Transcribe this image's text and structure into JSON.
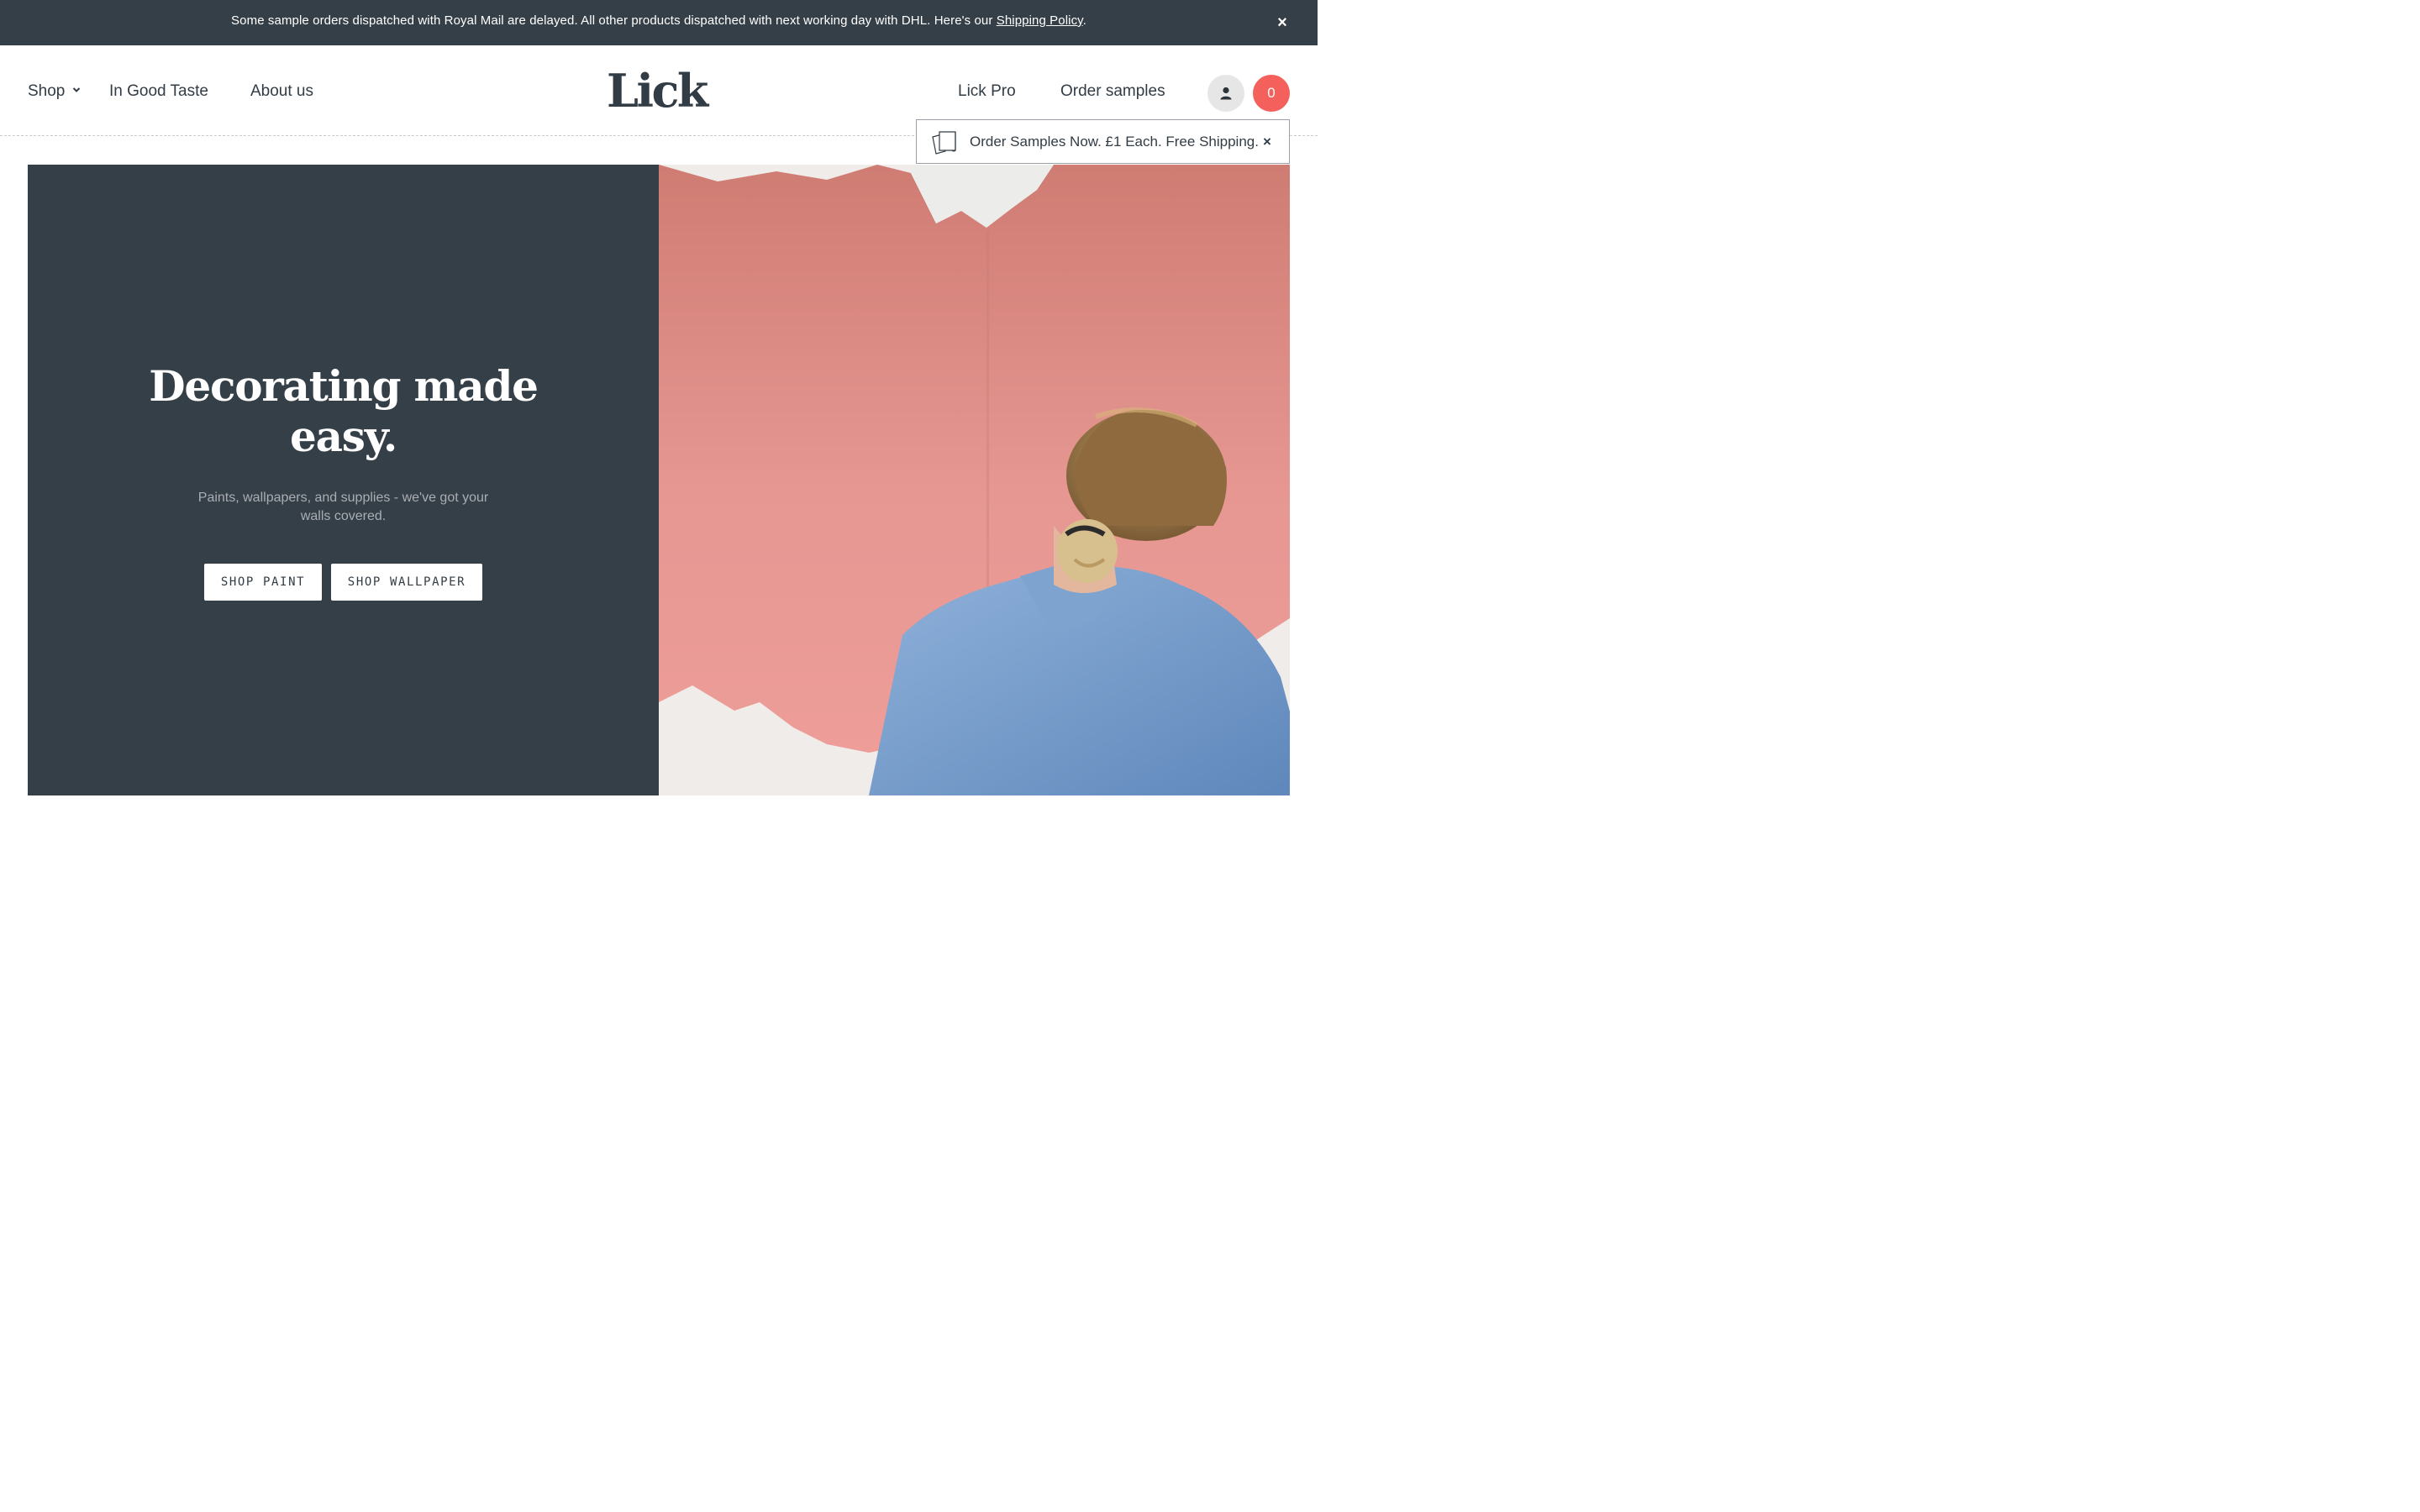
{
  "announcement": {
    "text": "Some sample orders dispatched with Royal Mail are delayed. All other products dispatched with next working day with DHL. Here's our ",
    "link_text": "Shipping Policy",
    "suffix": ".",
    "close_icon": "close-icon"
  },
  "header": {
    "nav_left": {
      "shop": "Shop",
      "in_good_taste": "In Good Taste",
      "about": "About us"
    },
    "logo": "Lick",
    "nav_right": {
      "pro": "Lick Pro",
      "samples": "Order samples"
    },
    "account_icon": "user-icon",
    "cart_count": "0"
  },
  "samples_popup": {
    "icon": "sample-cards-icon",
    "message": "Order Samples Now. £1 Each. Free Shipping.",
    "close_icon": "close-icon"
  },
  "hero": {
    "title": "Decorating made easy.",
    "subtitle": "Paints, wallpapers, and supplies - we've got your walls covered.",
    "buttons": {
      "paint": "SHOP PAINT",
      "wallpaper": "SHOP WALLPAPER"
    },
    "image": "woman-painting-pink-wall-photo"
  },
  "colors": {
    "dark": "#353f47",
    "accent": "#f4605b",
    "paint_pink": "#e88a88"
  }
}
